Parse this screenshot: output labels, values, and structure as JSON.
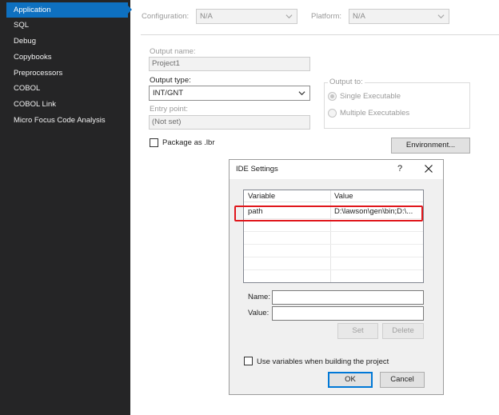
{
  "sidebar": {
    "items": [
      {
        "label": "Application",
        "active": true
      },
      {
        "label": "SQL"
      },
      {
        "label": "Debug"
      },
      {
        "label": "Copybooks"
      },
      {
        "label": "Preprocessors"
      },
      {
        "label": "COBOL"
      },
      {
        "label": "COBOL Link"
      },
      {
        "label": "Micro Focus Code Analysis"
      }
    ]
  },
  "toolbar": {
    "configuration_label": "Configuration:",
    "configuration_value": "N/A",
    "platform_label": "Platform:",
    "platform_value": "N/A"
  },
  "form": {
    "output_name_label": "Output name:",
    "output_name_value": "Project1",
    "output_type_label": "Output type:",
    "output_type_value": "INT/GNT",
    "entry_point_label": "Entry point:",
    "entry_point_value": "(Not set)",
    "output_to_label": "Output to:",
    "single_executable_label": "Single Executable",
    "multiple_executables_label": "Multiple Executables",
    "package_lbr_label": "Package as .lbr",
    "environment_button": "Environment..."
  },
  "dialog": {
    "title": "IDE Settings",
    "help_glyph": "?",
    "columns": [
      "Variable",
      "Value"
    ],
    "rows": [
      {
        "variable": "path",
        "value": "D:\\lawson\\gen\\bin;D:\\..."
      }
    ],
    "name_label": "Name:",
    "value_label": "Value:",
    "set_button": "Set",
    "delete_button": "Delete",
    "use_variables_label": "Use variables when building the project",
    "ok_button": "OK",
    "cancel_button": "Cancel"
  },
  "colors": {
    "sidebar_bg": "#252526",
    "active_item": "#0e70c0",
    "highlight_border": "#e0171c",
    "default_button_border": "#0078d7"
  }
}
